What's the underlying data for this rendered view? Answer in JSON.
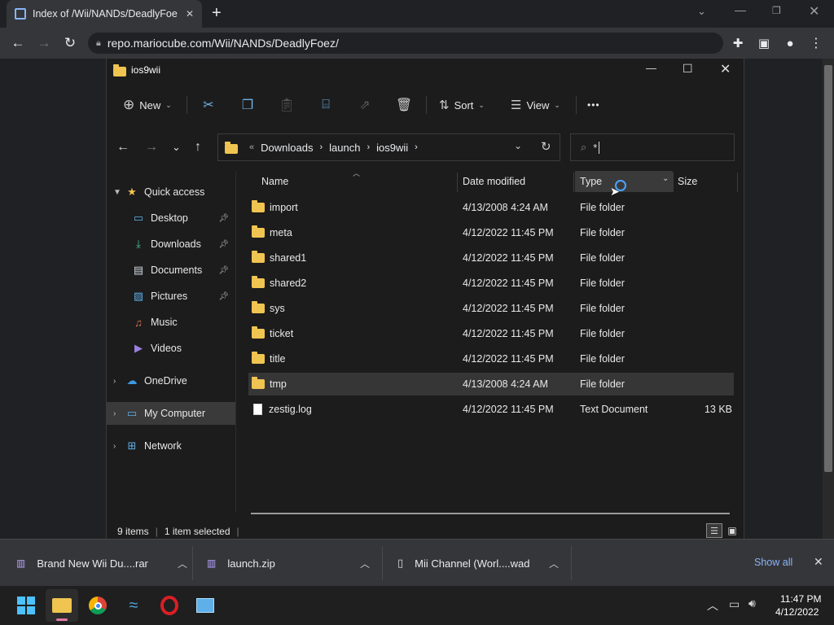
{
  "browser": {
    "tab_title": "Index of /Wii/NANDs/DeadlyFoe",
    "tab_close": "✕",
    "new_tab": "+",
    "url": "repo.mariocube.com/Wii/NANDs/DeadlyFoez/"
  },
  "explorer": {
    "window_title": "ios9wii",
    "commands": {
      "new_label": "New",
      "sort_label": "Sort",
      "view_label": "View",
      "more_label": "•••"
    },
    "breadcrumb": {
      "overflow": "«",
      "parts": [
        "Downloads",
        "launch",
        "ios9wii"
      ]
    },
    "search": {
      "value": "*"
    },
    "nav": {
      "quick_access": "Quick access",
      "desktop": "Desktop",
      "downloads": "Downloads",
      "documents": "Documents",
      "pictures": "Pictures",
      "music": "Music",
      "videos": "Videos",
      "onedrive": "OneDrive",
      "my_computer": "My Computer",
      "network": "Network"
    },
    "columns": {
      "name": "Name",
      "date": "Date modified",
      "type": "Type",
      "size": "Size"
    },
    "files": [
      {
        "name": "import",
        "date": "4/13/2008 4:24 AM",
        "type": "File folder",
        "size": ""
      },
      {
        "name": "meta",
        "date": "4/12/2022 11:45 PM",
        "type": "File folder",
        "size": ""
      },
      {
        "name": "shared1",
        "date": "4/12/2022 11:45 PM",
        "type": "File folder",
        "size": ""
      },
      {
        "name": "shared2",
        "date": "4/12/2022 11:45 PM",
        "type": "File folder",
        "size": ""
      },
      {
        "name": "sys",
        "date": "4/12/2022 11:45 PM",
        "type": "File folder",
        "size": ""
      },
      {
        "name": "ticket",
        "date": "4/12/2022 11:45 PM",
        "type": "File folder",
        "size": ""
      },
      {
        "name": "title",
        "date": "4/12/2022 11:45 PM",
        "type": "File folder",
        "size": ""
      },
      {
        "name": "tmp",
        "date": "4/13/2008 4:24 AM",
        "type": "File folder",
        "size": ""
      },
      {
        "name": "zestig.log",
        "date": "4/12/2022 11:45 PM",
        "type": "Text Document",
        "size": "13 KB"
      }
    ],
    "status": {
      "items": "9 items",
      "selected": "1 item selected"
    }
  },
  "downloads_bar": {
    "items": [
      {
        "name": "Brand New Wii Du....rar"
      },
      {
        "name": "launch.zip"
      },
      {
        "name": "Mii Channel (Worl....wad"
      }
    ],
    "show_all": "Show all",
    "close": "✕"
  },
  "taskbar": {
    "time": "11:47 PM",
    "date": "4/12/2022"
  },
  "colors": {
    "accent": "#8ab4f8",
    "folder": "#f0c451",
    "show_all": "#8ab4f8"
  }
}
